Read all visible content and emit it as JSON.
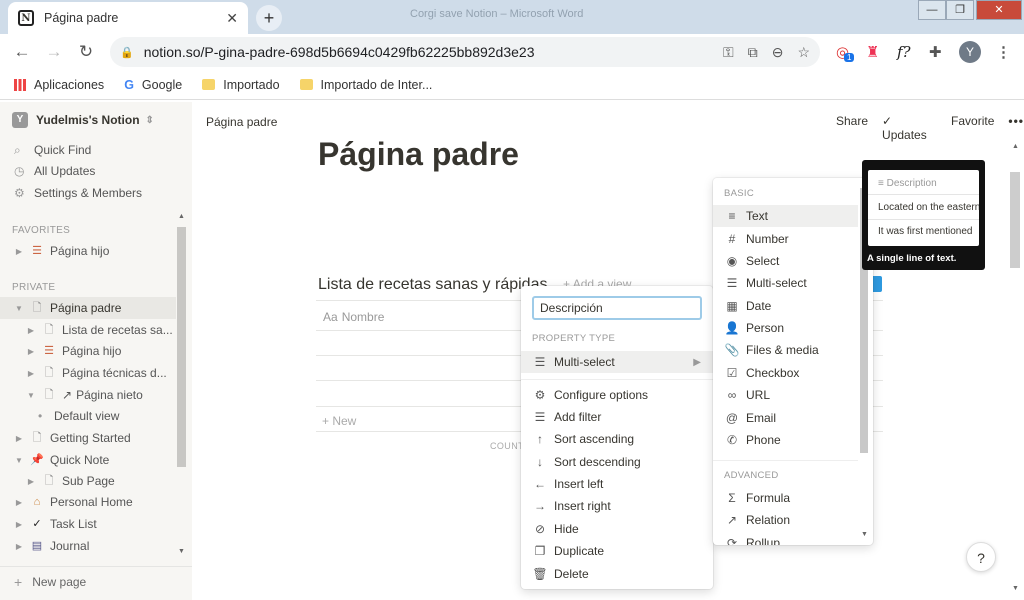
{
  "browser": {
    "tab_title": "Página padre",
    "tab_icon": "N",
    "window_title": "Corgi save Notion – Microsoft Word",
    "url": "notion.so/P-gina-padre-698d5b6694c0429fb62225bb892d3e23",
    "ext_badge": "1",
    "avatar": "Y",
    "bookmarks": [
      {
        "label": "Aplicaciones"
      },
      {
        "label": "Google"
      },
      {
        "label": "Importado"
      },
      {
        "label": "Importado de Inter..."
      }
    ]
  },
  "sidebar": {
    "workspace": "Yudelmis's Notion",
    "workspace_icon": "Y",
    "top_items": [
      {
        "label": "Quick Find",
        "icon": "search-icon"
      },
      {
        "label": "All Updates",
        "icon": "clock-icon"
      },
      {
        "label": "Settings & Members",
        "icon": "gear-icon"
      }
    ],
    "favorites_header": "FAVORITES",
    "private_header": "PRIVATE",
    "favorites": [
      {
        "label": "Página hijo"
      }
    ],
    "private": [
      {
        "label": "Página padre"
      },
      {
        "label": "Lista de recetas sa..."
      },
      {
        "label": "Página hijo"
      },
      {
        "label": "Página técnicas d..."
      },
      {
        "label": "Página nieto"
      },
      {
        "label": "Default view"
      },
      {
        "label": "Getting Started"
      },
      {
        "label": "Quick Note"
      },
      {
        "label": "Sub Page"
      },
      {
        "label": "Personal Home"
      },
      {
        "label": "Task List"
      },
      {
        "label": "Journal"
      }
    ],
    "new_page": "New page"
  },
  "topbar": {
    "breadcrumb": "Página padre",
    "share": "Share",
    "updates": "Updates",
    "favorite": "Favorite"
  },
  "page": {
    "title": "Página padre",
    "db_title": "Lista de recetas sanas y rápidas",
    "add_view": "Add a view",
    "col_name": "Nombre",
    "new_row": "New",
    "count": "COUNT"
  },
  "prop_menu": {
    "input_value": "Descripción",
    "type_header": "PROPERTY TYPE",
    "type_value": "Multi-select",
    "actions": [
      {
        "label": "Configure options"
      },
      {
        "label": "Add filter"
      },
      {
        "label": "Sort ascending"
      },
      {
        "label": "Sort descending"
      },
      {
        "label": "Insert left"
      },
      {
        "label": "Insert right"
      },
      {
        "label": "Hide"
      },
      {
        "label": "Duplicate"
      },
      {
        "label": "Delete"
      }
    ]
  },
  "type_menu": {
    "basic_header": "BASIC",
    "advanced_header": "ADVANCED",
    "basic": [
      {
        "label": "Text"
      },
      {
        "label": "Number"
      },
      {
        "label": "Select"
      },
      {
        "label": "Multi-select"
      },
      {
        "label": "Date"
      },
      {
        "label": "Person"
      },
      {
        "label": "Files & media"
      },
      {
        "label": "Checkbox"
      },
      {
        "label": "URL"
      },
      {
        "label": "Email"
      },
      {
        "label": "Phone"
      }
    ],
    "advanced": [
      {
        "label": "Formula"
      },
      {
        "label": "Relation"
      },
      {
        "label": "Rollup"
      }
    ]
  },
  "tooltip": {
    "header": "Description",
    "row1": "Located on the eastern",
    "row2": "It was first mentioned",
    "caption": "A single line of text."
  },
  "help": "?"
}
